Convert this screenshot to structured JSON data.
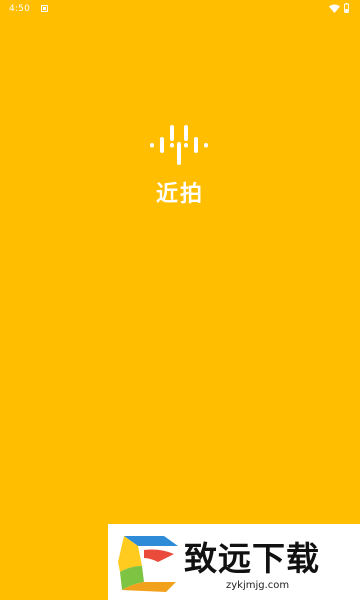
{
  "status_bar": {
    "time": "4:50",
    "notification_icon": "android-notification-icon",
    "wifi_icon": "wifi-icon",
    "battery_icon": "battery-icon"
  },
  "splash": {
    "logo_icon": "audio-waveform-icon",
    "app_name": "近拍",
    "background_color": "#FFBE00"
  },
  "watermark": {
    "logo_icon": "zhiyuan-logo-icon",
    "title": "致远下载",
    "url": "zykjmjg.com"
  }
}
